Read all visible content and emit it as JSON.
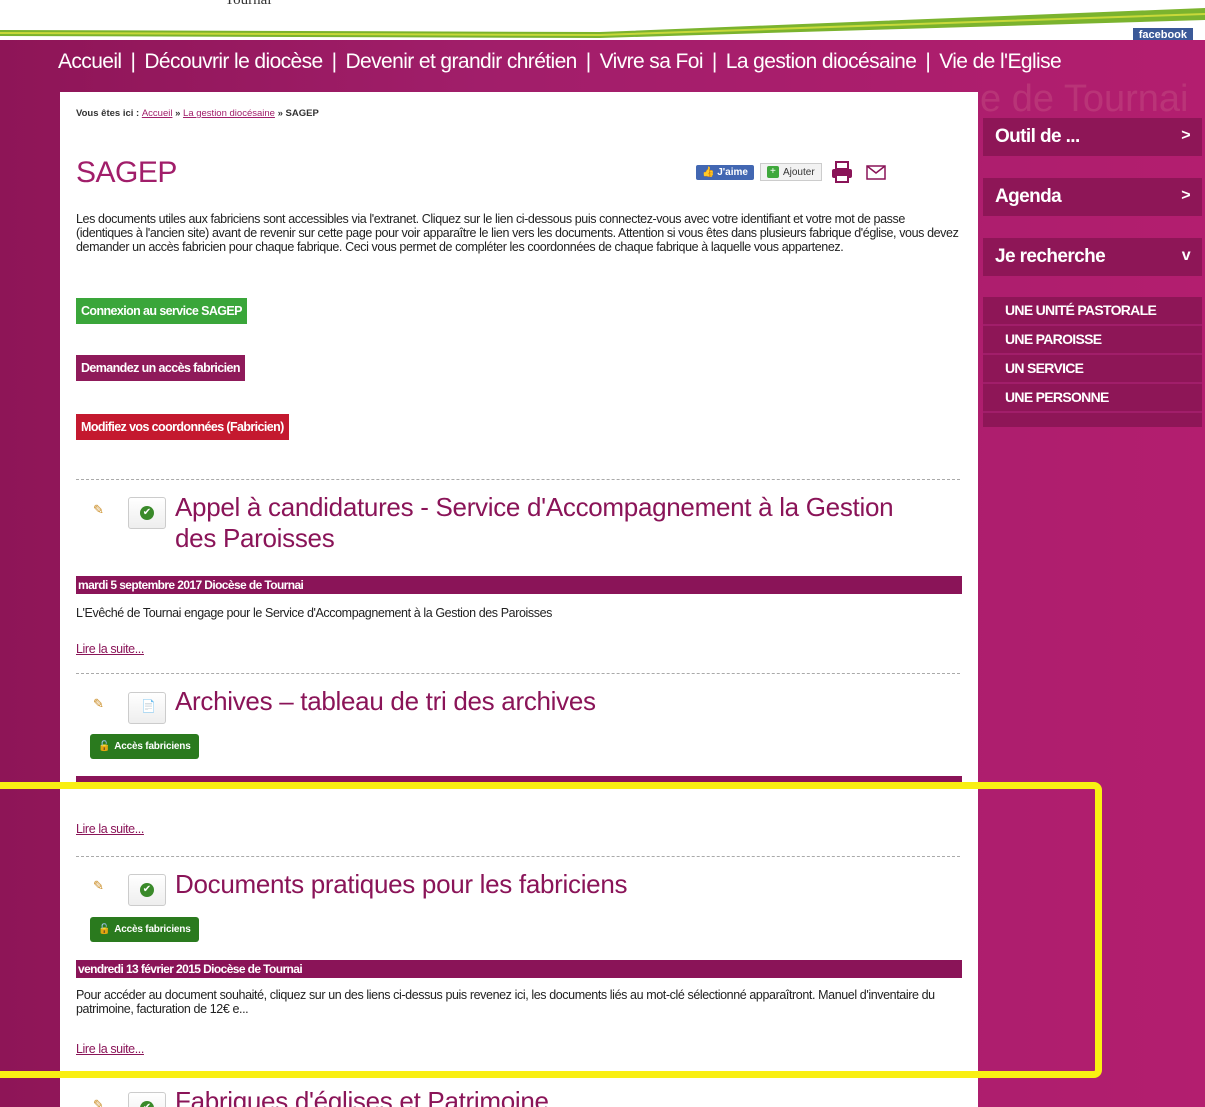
{
  "header": {
    "logo_text": "Tournai",
    "facebook_label": "facebook"
  },
  "nav": {
    "items": [
      "Accueil",
      "Découvrir le diocèse",
      "Devenir et grandir chrétien",
      "Vivre sa Foi",
      "La gestion diocésaine",
      "Vie de l'Eglise"
    ],
    "separator": "|"
  },
  "background_title": "e de Tournai",
  "breadcrumb": {
    "prefix": "Vous êtes ici :",
    "items": [
      "Accueil",
      "La gestion diocésaine"
    ],
    "separator": "»",
    "current": "SAGEP"
  },
  "page": {
    "title": "SAGEP",
    "share": {
      "like_label": "J'aime",
      "add_label": "Ajouter"
    },
    "intro": "Les documents utiles aux fabriciens sont accessibles via l'extranet. Cliquez sur le lien ci-dessous puis connectez-vous avec votre identifiant et votre mot de passe (identiques à l'ancien site) avant de revenir sur cette page pour voir apparaître le lien vers les documents. Attention si vous êtes dans plusieurs fabrique d'église, vous devez demander un accès fabricien pour chaque fabrique. Ceci vous permet de compléter les coordonnées de chaque fabrique à laquelle vous appartenez.",
    "buttons": {
      "connexion": "Connexion au service SAGEP",
      "demande": "Demandez un accès fabricien",
      "modifier": "Modifiez vos coordonnées (Fabricien)"
    }
  },
  "articles": [
    {
      "title": "Appel à candidatures - Service d'Accompagnement à la Gestion des Paroisses",
      "meta": "mardi 5 septembre 2017   Diocèse de Tournai",
      "excerpt": "L'Evêché de Tournai engage pour le Service d'Accompagnement à la Gestion des Paroisses",
      "read_more": "Lire la suite..."
    },
    {
      "title": "Archives – tableau de tri des archives",
      "access_label": "Accès fabriciens",
      "read_more": "Lire la suite..."
    },
    {
      "title": "Documents pratiques pour les fabriciens",
      "access_label": "Accès fabriciens",
      "meta": "vendredi 13 février 2015   Diocèse de Tournai",
      "excerpt": "Pour accéder au document souhaité, cliquez sur un des liens ci-dessus puis revenez ici, les documents liés au mot-clé sélectionné apparaîtront. Manuel d'inventaire du patrimoine, facturation de 12€ e...",
      "read_more": "Lire la suite..."
    },
    {
      "title": "Fabriques d'églises et Patrimoine"
    }
  ],
  "sidebar": {
    "items": [
      {
        "label": "Outil de ...",
        "arrow": ">"
      },
      {
        "label": "Agenda",
        "arrow": ">"
      },
      {
        "label": "Je recherche",
        "arrow": "v"
      }
    ],
    "search_options": [
      "UNE UNITÉ PASTORALE",
      "UNE PAROISSE",
      "UN SERVICE",
      "UNE PERSONNE"
    ]
  },
  "colors": {
    "brand_purple": "#a11e6a",
    "dark_purple": "#8a1458",
    "green": "#3aa63a",
    "red": "#c4192f",
    "highlight": "#f9ef13"
  }
}
